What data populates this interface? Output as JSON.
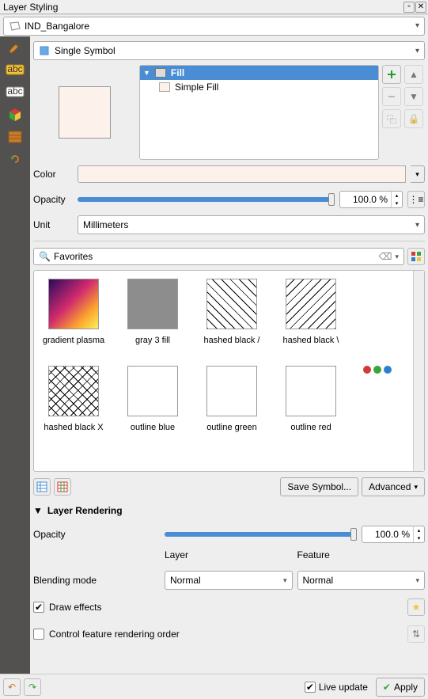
{
  "title": "Layer Styling",
  "layer": {
    "name": "IND_Bangalore"
  },
  "symbol_type": "Single Symbol",
  "tree": {
    "root": "Fill",
    "child": "Simple Fill"
  },
  "props": {
    "color_label": "Color",
    "opacity_label": "Opacity",
    "opacity_value": "100.0 %",
    "unit_label": "Unit",
    "unit_value": "Millimeters"
  },
  "search": {
    "text": "Favorites"
  },
  "gallery": [
    {
      "name": "gradient plasma"
    },
    {
      "name": "gray 3 fill"
    },
    {
      "name": "hashed black /"
    },
    {
      "name": "hashed black \\"
    },
    {
      "name": "hashed black X"
    },
    {
      "name": "outline blue"
    },
    {
      "name": "outline green"
    },
    {
      "name": "outline red"
    }
  ],
  "buttons": {
    "save_symbol": "Save Symbol...",
    "advanced": "Advanced"
  },
  "rendering": {
    "title": "Layer Rendering",
    "opacity_label": "Opacity",
    "opacity_value": "100.0 %",
    "blend_label": "Blending mode",
    "layer_col": "Layer",
    "feature_col": "Feature",
    "layer_blend": "Normal",
    "feature_blend": "Normal",
    "draw_effects": "Draw effects",
    "control_order": "Control feature rendering order"
  },
  "footer": {
    "live_update": "Live update",
    "apply": "Apply"
  }
}
